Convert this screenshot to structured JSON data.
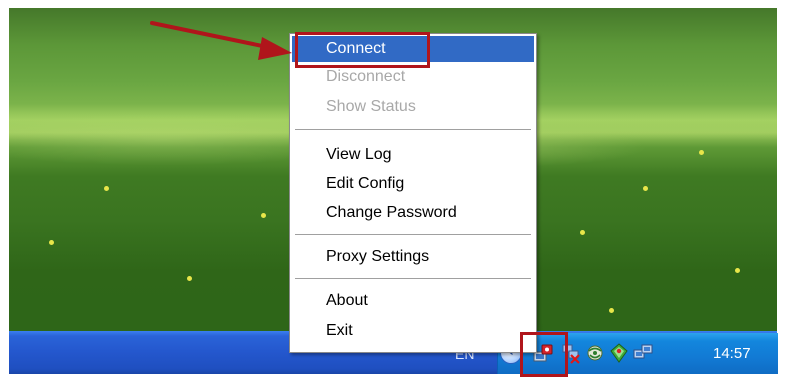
{
  "context_menu": {
    "items": [
      {
        "label": "Connect",
        "state": "selected"
      },
      {
        "label": "Disconnect",
        "state": "disabled"
      },
      {
        "label": "Show Status",
        "state": "disabled"
      },
      {
        "label": "View Log",
        "state": "enabled"
      },
      {
        "label": "Edit Config",
        "state": "enabled"
      },
      {
        "label": "Change Password",
        "state": "enabled"
      },
      {
        "label": "Proxy Settings",
        "state": "enabled"
      },
      {
        "label": "About",
        "state": "enabled"
      },
      {
        "label": "Exit",
        "state": "enabled"
      }
    ]
  },
  "taskbar": {
    "language": "EN",
    "clock": "14:57",
    "tray_icons": [
      "openvpn-gui-icon",
      "network-disconnected-icon",
      "network-connection-icon",
      "security-center-icon",
      "network-computers-icon"
    ]
  },
  "annotations": {
    "color": "#b0151b",
    "highlight_targets": [
      "menu-item-connect",
      "openvpn-tray-icon"
    ]
  },
  "colors": {
    "menu_highlight": "#316ac5",
    "taskbar": "#2457cd",
    "tray": "#127ad4"
  }
}
